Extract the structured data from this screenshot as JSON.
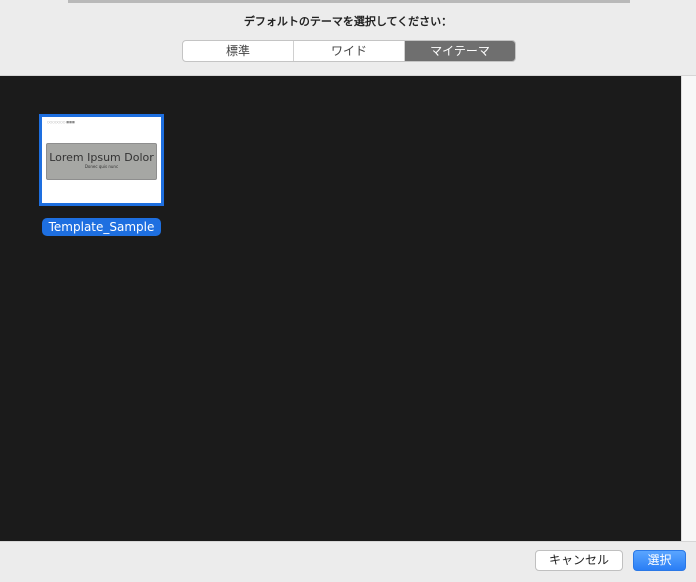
{
  "header": {
    "prompt": "デフォルトのテーマを選択してください：",
    "tabs": [
      {
        "label": "標準",
        "selected": false
      },
      {
        "label": "ワイド",
        "selected": false
      },
      {
        "label": "マイテーマ",
        "selected": true
      }
    ]
  },
  "themes": [
    {
      "name": "Template_Sample",
      "thumb_title": "Lorem Ipsum Dolor",
      "thumb_subtitle": "Donec quis nunc",
      "selected": true
    }
  ],
  "footer": {
    "cancel": "キャンセル",
    "select": "選択"
  },
  "colors": {
    "accent": "#1e6fe0",
    "browser_bg": "#1b1b1b"
  }
}
